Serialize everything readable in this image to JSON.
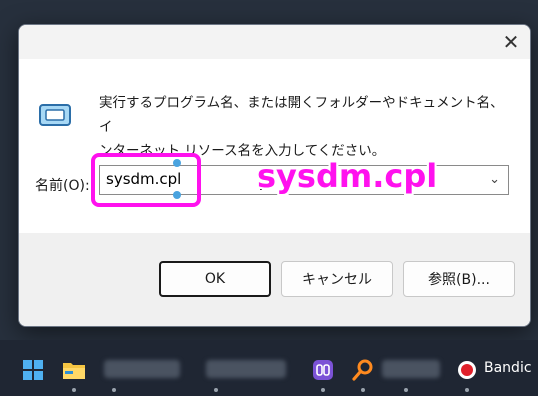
{
  "dialog": {
    "close_glyph": "✕",
    "message_line1": "実行するプログラム名、または開くフォルダーやドキュメント名、イ",
    "message_line2": "ンターネット リソース名を入力してください。",
    "name_label": "名前(O):",
    "input_value": "sysdm.cpl",
    "dropdown_glyph": "⌄",
    "buttons": {
      "ok": "OK",
      "cancel": "キャンセル",
      "browse": "参照(B)..."
    }
  },
  "annotation": {
    "overlay_text": "sysdm.cpl",
    "highlight_color": "#ff11ee"
  },
  "taskbar": {
    "items": [
      {
        "icon": "windows-start-icon"
      },
      {
        "icon": "file-explorer-icon"
      },
      {
        "icon": "blurred-app-icon"
      },
      {
        "icon": "blurred-app-icon"
      },
      {
        "icon": "devtoys-icon"
      },
      {
        "icon": "search-icon"
      },
      {
        "icon": "blurred-app-icon"
      },
      {
        "icon": "bandicam-record-icon"
      }
    ],
    "bandicam_label": "Bandic"
  }
}
